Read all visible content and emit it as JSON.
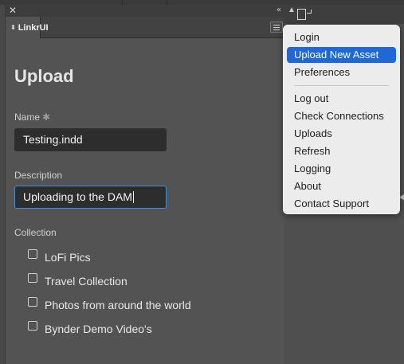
{
  "panel": {
    "tab_label": "LinkrUI",
    "tab_arrows": "⬍",
    "close_glyph": "✕",
    "collapse_glyph": "«",
    "menu_icon": "hamburger-menu-icon"
  },
  "form": {
    "title": "Upload",
    "name_label": "Name",
    "required_mark": "✱",
    "name_value": "Testing.indd",
    "description_label": "Description",
    "description_value": "Uploading to the DAM",
    "collection_label": "Collection",
    "collections": [
      {
        "label": "LoFi Pics",
        "checked": false
      },
      {
        "label": "Travel Collection",
        "checked": false
      },
      {
        "label": "Photos from around the world",
        "checked": false
      },
      {
        "label": "Bynder Demo Video's",
        "checked": false
      }
    ]
  },
  "context_menu": {
    "group1": [
      {
        "label": "Login",
        "selected": false
      },
      {
        "label": "Upload New Asset",
        "selected": true
      },
      {
        "label": "Preferences",
        "selected": false
      }
    ],
    "group2": [
      {
        "label": "Log out"
      },
      {
        "label": "Check Connections"
      },
      {
        "label": "Uploads"
      },
      {
        "label": "Refresh"
      },
      {
        "label": "Logging"
      },
      {
        "label": "About"
      },
      {
        "label": "Contact Support"
      }
    ]
  },
  "colors": {
    "accent": "#1f68d8",
    "focus_border": "#3d8ee0",
    "panel_bg": "#535353",
    "field_bg": "#2d2d2d"
  }
}
